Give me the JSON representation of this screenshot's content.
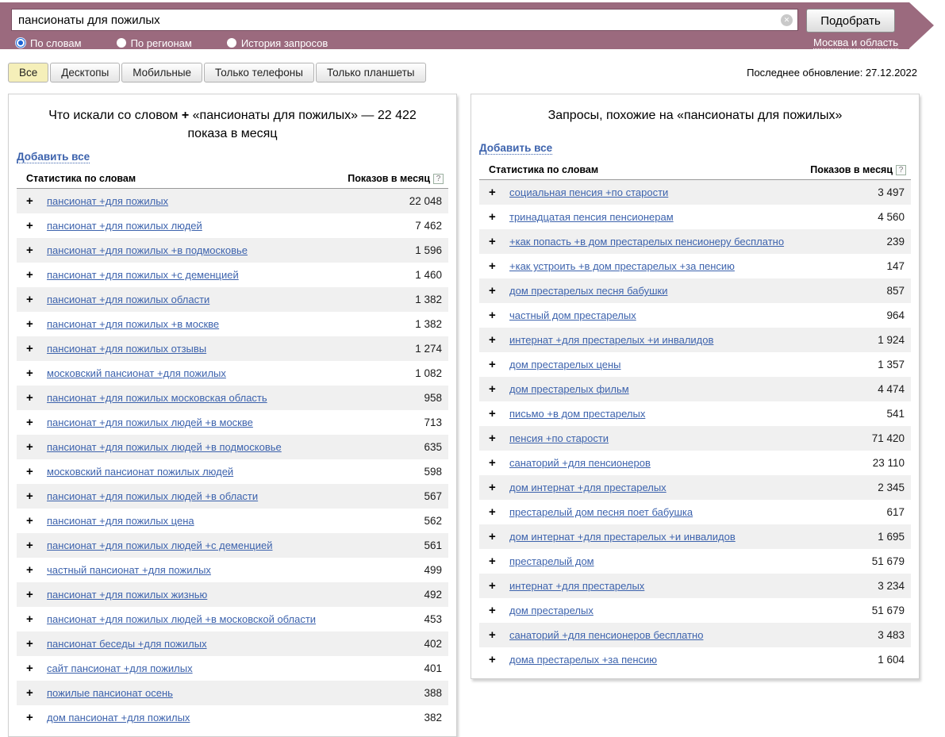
{
  "ui": {
    "plus_icon": "+",
    "clear_icon": "✕",
    "help_icon": "?"
  },
  "colors": {
    "header_band": "#9b6a7e",
    "link_blue": "#3d63ad",
    "active_tab": "#f5efb9",
    "row_stripe": "#f0f0f0"
  },
  "header": {
    "search_value": "пансионаты для пожилых",
    "submit_label": "Подобрать",
    "radios": [
      {
        "label": "По словам",
        "selected": true
      },
      {
        "label": "По регионам",
        "selected": false
      },
      {
        "label": "История запросов",
        "selected": false
      }
    ],
    "region_label": "Москва и область"
  },
  "tabs": {
    "items": [
      {
        "label": "Все",
        "active": true
      },
      {
        "label": "Десктопы",
        "active": false
      },
      {
        "label": "Мобильные",
        "active": false
      },
      {
        "label": "Только телефоны",
        "active": false
      },
      {
        "label": "Только планшеты",
        "active": false
      }
    ],
    "last_update": "Последнее обновление: 27.12.2022"
  },
  "left_panel": {
    "title_prefix": "Что искали со словом",
    "title_plus": "+",
    "title_suffix": "«пансионаты для пожилых» — 22 422 показа в месяц",
    "add_all_label": "Добавить все",
    "col_keyword": "Статистика по словам",
    "col_count": "Показов в месяц",
    "rows": [
      {
        "keyword": "пансионат +для пожилых",
        "count": "22 048"
      },
      {
        "keyword": "пансионат +для пожилых людей",
        "count": "7 462"
      },
      {
        "keyword": "пансионат +для пожилых +в подмосковье",
        "count": "1 596"
      },
      {
        "keyword": "пансионат +для пожилых +с деменцией",
        "count": "1 460"
      },
      {
        "keyword": "пансионат +для пожилых области",
        "count": "1 382"
      },
      {
        "keyword": "пансионат +для пожилых +в москве",
        "count": "1 382"
      },
      {
        "keyword": "пансионат +для пожилых отзывы",
        "count": "1 274"
      },
      {
        "keyword": "московский пансионат +для пожилых",
        "count": "1 082"
      },
      {
        "keyword": "пансионат +для пожилых московская область",
        "count": "958"
      },
      {
        "keyword": "пансионат +для пожилых людей +в москве",
        "count": "713"
      },
      {
        "keyword": "пансионат +для пожилых людей +в подмосковье",
        "count": "635"
      },
      {
        "keyword": "московский пансионат пожилых людей",
        "count": "598"
      },
      {
        "keyword": "пансионат +для пожилых людей +в области",
        "count": "567"
      },
      {
        "keyword": "пансионат +для пожилых цена",
        "count": "562"
      },
      {
        "keyword": "пансионат +для пожилых людей +с деменцией",
        "count": "561"
      },
      {
        "keyword": "частный пансионат +для пожилых",
        "count": "499"
      },
      {
        "keyword": "пансионат +для пожилых жизнью",
        "count": "492"
      },
      {
        "keyword": "пансионат +для пожилых людей +в московской области",
        "count": "453"
      },
      {
        "keyword": "пансионат беседы +для пожилых",
        "count": "402"
      },
      {
        "keyword": "сайт пансионат +для пожилых",
        "count": "401"
      },
      {
        "keyword": "пожилые пансионат осень",
        "count": "388"
      },
      {
        "keyword": "дом пансионат +для пожилых",
        "count": "382"
      }
    ]
  },
  "right_panel": {
    "title": "Запросы, похожие на «пансионаты для пожилых»",
    "add_all_label": "Добавить все",
    "col_keyword": "Статистика по словам",
    "col_count": "Показов в месяц",
    "rows": [
      {
        "keyword": "социальная пенсия +по старости",
        "count": "3 497"
      },
      {
        "keyword": "тринадцатая пенсия пенсионерам",
        "count": "4 560"
      },
      {
        "keyword": "+как попасть +в дом престарелых пенсионеру бесплатно",
        "count": "239"
      },
      {
        "keyword": "+как устроить +в дом престарелых +за пенсию",
        "count": "147"
      },
      {
        "keyword": "дом престарелых песня бабушки",
        "count": "857"
      },
      {
        "keyword": "частный дом престарелых",
        "count": "964"
      },
      {
        "keyword": "интернат +для престарелых +и инвалидов",
        "count": "1 924"
      },
      {
        "keyword": "дом престарелых цены",
        "count": "1 357"
      },
      {
        "keyword": "дом престарелых фильм",
        "count": "4 474"
      },
      {
        "keyword": "письмо +в дом престарелых",
        "count": "541"
      },
      {
        "keyword": "пенсия +по старости",
        "count": "71 420"
      },
      {
        "keyword": "санаторий +для пенсионеров",
        "count": "23 110"
      },
      {
        "keyword": "дом интернат +для престарелых",
        "count": "2 345"
      },
      {
        "keyword": "престарелый дом песня поет бабушка",
        "count": "617"
      },
      {
        "keyword": "дом интернат +для престарелых +и инвалидов",
        "count": "1 695"
      },
      {
        "keyword": "престарелый дом",
        "count": "51 679"
      },
      {
        "keyword": "интернат +для престарелых",
        "count": "3 234"
      },
      {
        "keyword": "дом престарелых",
        "count": "51 679"
      },
      {
        "keyword": "санаторий +для пенсионеров бесплатно",
        "count": "3 483"
      },
      {
        "keyword": "дома престарелых +за пенсию",
        "count": "1 604"
      }
    ]
  }
}
